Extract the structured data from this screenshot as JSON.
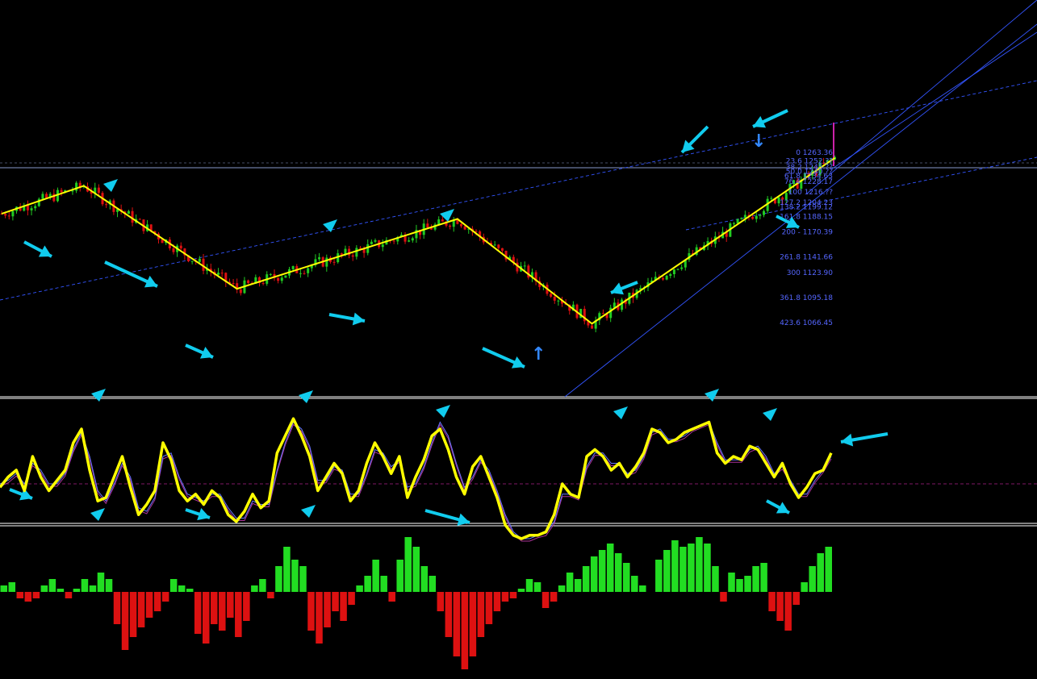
{
  "colors": {
    "background": "#000000",
    "bull_candle": "#22cc22",
    "bear_candle": "#dd1111",
    "zigzag": "#ffff00",
    "annotation_arrow": "#11ccee",
    "channel": "#3355ff",
    "fib_text": "#5566ff",
    "oscillator_main": "#ffff00",
    "oscillator_signal_1": "#6677ff",
    "oscillator_signal_2": "#aa3399",
    "histogram_positive": "#22dd22",
    "histogram_negative": "#dd1111",
    "pane_separator": "#ffffff"
  },
  "chart_data": [
    {
      "type": "candlestick",
      "pane": "price",
      "title": "",
      "zigzag_pivots": [
        {
          "bar": 0,
          "price": 1194
        },
        {
          "bar": 22,
          "price": 1226
        },
        {
          "bar": 63,
          "price": 1108
        },
        {
          "bar": 122,
          "price": 1188
        },
        {
          "bar": 158,
          "price": 1068
        },
        {
          "bar": 223,
          "price": 1258
        }
      ],
      "fib_levels": [
        {
          "ratio": "0",
          "price": "1263.36",
          "text": "0 1263.36"
        },
        {
          "ratio": "23.6",
          "price": "1252.??",
          "text": "23.6 1252.??"
        },
        {
          "ratio": "38.2",
          "price": "1245.??",
          "text": "38.2 1245.??"
        },
        {
          "ratio": "50.0",
          "price": "1240.??",
          "text": "50.0 1240.??"
        },
        {
          "ratio": "61.8",
          "price": "1234.63",
          "text": "61.8 1234.63"
        },
        {
          "ratio": "76.4",
          "price": "1228.17",
          "text": "76.4 1228.17"
        },
        {
          "ratio": "100",
          "price": "1216.??",
          "text": "100 1216.??"
        },
        {
          "ratio": "127.2",
          "price": "1204.23",
          "text": "127.2 1204.23"
        },
        {
          "ratio": "138.2",
          "price": "1199.12",
          "text": "138.2 1199.12"
        },
        {
          "ratio": "161.8",
          "price": "1188.15",
          "text": "161.8 1188.15"
        },
        {
          "ratio": "200",
          "price": "1170.39",
          "text": "200 - 1170.39"
        },
        {
          "ratio": "261.8",
          "price": "1141.66",
          "text": "261.8 1141.66"
        },
        {
          "ratio": "300",
          "price": "1123.90",
          "text": "300 1123.90"
        },
        {
          "ratio": "361.8",
          "price": "1095.18",
          "text": "361.8 1095.18"
        },
        {
          "ratio": "423.6",
          "price": "1066.45",
          "text": "423.6 1066.45"
        }
      ],
      "grid": false,
      "legend": "none"
    },
    {
      "type": "line",
      "pane": "oscillator",
      "series": [
        {
          "role": "main",
          "values": [
            -5,
            10,
            20,
            -10,
            40,
            10,
            -10,
            5,
            20,
            60,
            80,
            20,
            -25,
            -20,
            10,
            40,
            -5,
            -45,
            -30,
            -10,
            60,
            35,
            -10,
            -25,
            -15,
            -30,
            -10,
            -20,
            -45,
            -55,
            -40,
            -15,
            -35,
            -25,
            45,
            70,
            95,
            70,
            40,
            -10,
            10,
            30,
            15,
            -25,
            -10,
            30,
            60,
            40,
            15,
            40,
            -20,
            10,
            35,
            70,
            80,
            50,
            10,
            -15,
            25,
            40,
            10,
            -20,
            -60,
            -75,
            -80,
            -75,
            -75,
            -70,
            -45,
            0,
            -15,
            -20,
            40,
            50,
            40,
            20,
            30,
            10,
            25,
            45,
            80,
            75,
            60,
            65,
            75,
            80,
            85,
            90,
            45,
            30,
            40,
            35,
            55,
            50,
            30,
            10,
            30,
            0,
            -20,
            -5,
            15,
            20,
            45
          ]
        },
        {
          "role": "signal",
          "values": [
            0,
            5,
            15,
            0,
            30,
            20,
            0,
            0,
            15,
            50,
            75,
            40,
            -10,
            -25,
            0,
            30,
            10,
            -35,
            -40,
            -20,
            40,
            45,
            10,
            -15,
            -20,
            -25,
            -15,
            -15,
            -35,
            -50,
            -50,
            -25,
            -30,
            -30,
            20,
            60,
            90,
            80,
            55,
            5,
            5,
            25,
            20,
            -15,
            -15,
            15,
            50,
            45,
            25,
            35,
            -5,
            0,
            25,
            60,
            90,
            70,
            30,
            -5,
            10,
            35,
            20,
            -10,
            -45,
            -70,
            -80,
            -80,
            -75,
            -72,
            -55,
            -15,
            -15,
            -20,
            25,
            45,
            45,
            30,
            30,
            15,
            20,
            40,
            75,
            80,
            65,
            65,
            70,
            80,
            85,
            90,
            60,
            35,
            35,
            35,
            50,
            55,
            40,
            15,
            25,
            5,
            -15,
            -15,
            5,
            20,
            40
          ]
        }
      ],
      "grid": false,
      "legend": "none"
    },
    {
      "type": "bar",
      "pane": "histogram",
      "values": [
        2,
        3,
        -2,
        -3,
        -2,
        2,
        4,
        1,
        -2,
        1,
        4,
        2,
        6,
        4,
        -10,
        -18,
        -14,
        -11,
        -8,
        -6,
        -3,
        4,
        2,
        1,
        -13,
        -16,
        -10,
        -12,
        -8,
        -14,
        -9,
        2,
        4,
        -2,
        8,
        14,
        10,
        8,
        -12,
        -16,
        -11,
        -6,
        -9,
        -4,
        2,
        5,
        10,
        5,
        -3,
        10,
        17,
        14,
        8,
        5,
        -6,
        -14,
        -20,
        -24,
        -20,
        -14,
        -10,
        -6,
        -3,
        -2,
        1,
        4,
        3,
        -5,
        -3,
        2,
        6,
        4,
        8,
        11,
        13,
        15,
        12,
        9,
        5,
        2,
        0,
        10,
        13,
        16,
        14,
        15,
        17,
        15,
        8,
        -3,
        6,
        4,
        5,
        8,
        9,
        -6,
        -9,
        -12,
        -4,
        3,
        8,
        12,
        14
      ]
    }
  ]
}
